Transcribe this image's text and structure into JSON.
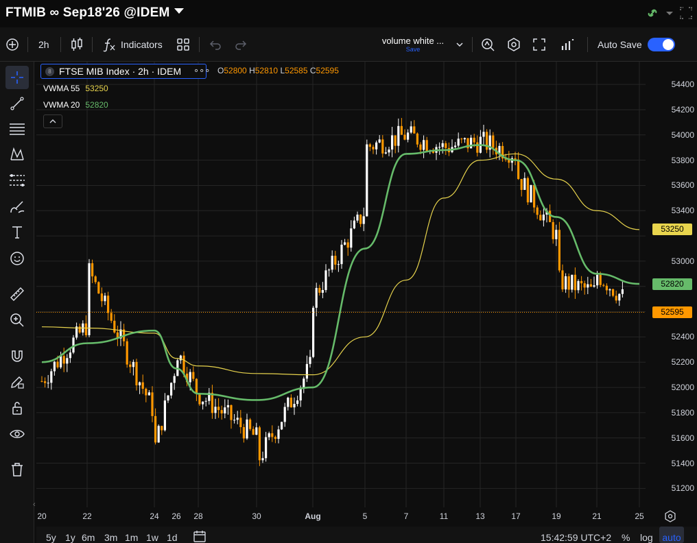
{
  "header": {
    "title": "FTMIB ∞ Sep18'26 @IDEM"
  },
  "toolbar": {
    "interval": "2h",
    "indicators_label": "Indicators",
    "layout_name": "volume white ...",
    "layout_save": "Save",
    "auto_save_label": "Auto Save"
  },
  "legend": {
    "instrument": "FTSE MIB Index · 2h · IDEM",
    "badge": "8",
    "dots": "∘∘∘",
    "ohlc": {
      "o_label": "O",
      "o_value": "52800",
      "h_label": "H",
      "h_value": "52810",
      "l_label": "L",
      "l_value": "52585",
      "c_label": "C",
      "c_value": "52595"
    },
    "vwma55": {
      "name": "VWMA 55",
      "value": "53250"
    },
    "vwma20": {
      "name": "VWMA 20",
      "value": "52820"
    }
  },
  "colors": {
    "candle_up": "#ffffff",
    "candle_down": "#ff9800",
    "vwma55": "#e8d44d",
    "vwma20": "#66bb6a",
    "accent": "#2962ff",
    "background": "#0e0e0e"
  },
  "price_axis": {
    "ticks": [
      "54400",
      "54200",
      "54000",
      "53800",
      "53600",
      "53400",
      "53250",
      "53000",
      "52820",
      "52595",
      "52400",
      "52200",
      "52000",
      "51800",
      "51600",
      "51400",
      "51200"
    ],
    "labels": [
      {
        "text": "53250",
        "price": 53250,
        "color": "#e8d44d"
      },
      {
        "text": "52820",
        "price": 52820,
        "color": "#66bb6a"
      },
      {
        "text": "52595",
        "price": 52595,
        "color": "#ff9800"
      }
    ]
  },
  "time_axis": {
    "ticks": [
      "20",
      "22",
      "24",
      "26",
      "28",
      "30",
      "Aug",
      "5",
      "7",
      "11",
      "13",
      "17",
      "19",
      "21",
      "25"
    ]
  },
  "bottom_bar": {
    "ranges": [
      "5y",
      "1y",
      "6m",
      "3m",
      "1m",
      "1w",
      "1d"
    ],
    "clock": "15:42:59 UTC+2",
    "percent": "%",
    "log": "log",
    "auto": "auto"
  },
  "chart_data": {
    "type": "candlestick",
    "y_range": [
      51050,
      54580
    ],
    "last_price": 52595,
    "price_gridlines": [
      51200,
      51400,
      51600,
      51800,
      52000,
      52200,
      52400,
      52600,
      52800,
      53000,
      53200,
      53400,
      53600,
      53800,
      54000,
      54200,
      54400
    ],
    "date_gridlines": [
      "Jul 22",
      "Jul 24",
      "Jul 28",
      "Jul 30",
      "Aug 1",
      "Aug 5",
      "Aug 7",
      "Aug 11",
      "Aug 13",
      "Aug 17",
      "Aug 19",
      "Aug 21",
      "Aug 25"
    ],
    "anchors": [
      {
        "label": "20",
        "date": "Jul 20",
        "price": 52050
      },
      {
        "label": "22",
        "date": "Jul 22",
        "price": 52500
      },
      {
        "label": "22",
        "date": "Jul 22",
        "price": 52950
      },
      {
        "label": "24",
        "date": "Jul 24",
        "price": 51800
      },
      {
        "label": "24",
        "date": "Jul 24",
        "price": 51500
      },
      {
        "label": "26",
        "date": "Jul 26",
        "price": 52200
      },
      {
        "label": "26",
        "date": "Jul 26",
        "price": 52300
      },
      {
        "label": "28",
        "date": "Jul 28",
        "price": 51950
      },
      {
        "label": "30",
        "date": "Jul 30",
        "price": 51600
      },
      {
        "label": "30",
        "date": "Jul 30",
        "price": 51400
      },
      {
        "label": "Aug",
        "date": "Aug 1",
        "price": 52200
      },
      {
        "label": "Aug",
        "date": "Aug 1",
        "price": 52700
      },
      {
        "label": "5",
        "date": "Aug 5",
        "price": 53400
      },
      {
        "label": "5",
        "date": "Aug 5",
        "price": 53900
      },
      {
        "label": "7",
        "date": "Aug 7",
        "price": 54000
      },
      {
        "label": "11",
        "date": "Aug 11",
        "price": 53900
      },
      {
        "label": "13",
        "date": "Aug 13",
        "price": 53950
      },
      {
        "label": "17",
        "date": "Aug 17",
        "price": 53850
      },
      {
        "label": "17",
        "date": "Aug 17",
        "price": 53700
      },
      {
        "label": "19",
        "date": "Aug 19",
        "price": 53200
      },
      {
        "label": "19",
        "date": "Aug 19",
        "price": 52850
      },
      {
        "label": "21",
        "date": "Aug 21",
        "price": 52750
      },
      {
        "label": "21",
        "date": "Aug 21",
        "price": 52900
      },
      {
        "label": "25",
        "date": "Aug 25",
        "price": 52595
      }
    ],
    "series": [
      {
        "name": "VWMA 55",
        "color": "#e8d44d",
        "points": [
          [
            "Jul 20",
            52480
          ],
          [
            "Jul 22",
            52470
          ],
          [
            "Jul 24",
            52430
          ],
          [
            "Jul 26",
            52230
          ],
          [
            "Jul 28",
            52170
          ],
          [
            "Jul 30",
            52110
          ],
          [
            "Aug 1",
            52100
          ],
          [
            "Aug 5",
            52400
          ],
          [
            "Aug 7",
            52850
          ],
          [
            "Aug 11",
            53500
          ],
          [
            "Aug 13",
            53800
          ],
          [
            "Aug 17",
            53850
          ],
          [
            "Aug 19",
            53650
          ],
          [
            "Aug 21",
            53400
          ],
          [
            "Aug 25",
            53250
          ]
        ]
      },
      {
        "name": "VWMA 20",
        "color": "#66bb6a",
        "points": [
          [
            "Jul 20",
            52200
          ],
          [
            "Jul 22",
            52350
          ],
          [
            "Jul 24",
            52450
          ],
          [
            "Jul 26",
            52150
          ],
          [
            "Jul 28",
            51950
          ],
          [
            "Jul 30",
            51900
          ],
          [
            "Aug 1",
            52000
          ],
          [
            "Aug 5",
            53100
          ],
          [
            "Aug 7",
            53850
          ],
          [
            "Aug 11",
            53880
          ],
          [
            "Aug 13",
            53920
          ],
          [
            "Aug 17",
            53800
          ],
          [
            "Aug 19",
            53350
          ],
          [
            "Aug 21",
            52900
          ],
          [
            "Aug 25",
            52820
          ]
        ]
      }
    ]
  }
}
